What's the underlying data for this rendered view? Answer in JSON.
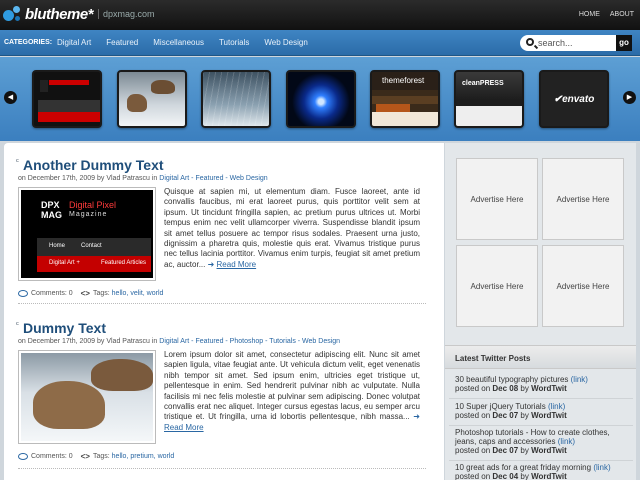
{
  "brand": {
    "logo": "blutheme*",
    "domain": "dpxmag.com"
  },
  "top_nav": [
    "HOME",
    "ABOUT"
  ],
  "categories": {
    "label": "CATEGORIES:",
    "items": [
      "Digital Art",
      "Featured",
      "Miscellaneous",
      "Tutorials",
      "Web Design"
    ]
  },
  "search": {
    "placeholder": "search...",
    "button": "go"
  },
  "carousel": {
    "prev": "◀",
    "next": "▶",
    "thumbs": [
      "DPX Digital Pixel Magazine",
      "Cougars in snow",
      "Snow storm",
      "Blue orb",
      "themeforest",
      "cleanpress",
      "envato"
    ],
    "labels": {
      "themeforest": "themeforest",
      "cleanpress": "cleanPRESS",
      "envato": "✔envato"
    }
  },
  "posts": [
    {
      "title": "Another Dummy Text",
      "meta": {
        "prefix": "on December 17th, 2009 by Vlad Patrascu in",
        "cats": "Digital Art - Featured - Web Design"
      },
      "image": {
        "dpx": "DPX",
        "mag": "MAG",
        "title": "Digital Pixel",
        "subtitle": "Magazine",
        "nav1": "Home",
        "nav2": "Contact",
        "red1": "Digital Art +",
        "red2": "Featured Articles"
      },
      "excerpt": "Quisque at sapien mi, ut elementum diam. Fusce laoreet, ante id convallis faucibus, mi erat laoreet purus, quis porttitor velit sem at ipsum. Ut tincidunt fringilla sapien, ac pretium purus ultrices ut. Morbi tempus enim nec velit ullamcorper viverra. Suspendisse blandit ipsum sit amet tellus posuere ac tempor risus sodales. Praesent urna justo, dignissim a pharetra quis, molestie quis erat. Vivamus tristique purus nec tellus lacinia porttitor. Vivamus enim turpis, feugiat sit amet pretium ac, auctor...",
      "read_more": "Read More",
      "comments": "Comments: 0",
      "tags_prefix": "Tags:",
      "tags": "hello, velit, world"
    },
    {
      "title": "Dummy Text",
      "meta": {
        "prefix": "on December 17th, 2009 by Vlad Patrascu in",
        "cats": "Digital Art - Featured - Photoshop - Tutorials - Web Design"
      },
      "excerpt": "Lorem ipsum dolor sit amet, consectetur adipiscing elit. Nunc sit amet sapien ligula, vitae feugiat ante. Ut vehicula dictum velit, eget venenatis nibh tempor sit amet. Sed ipsum enim, ultricies eget tristique ut, pellentesque in enim. Sed hendrerit pulvinar nibh ac vulputate. Nulla facilisis mi nec felis molestie at pulvinar sem adipiscing. Donec volutpat convallis erat nec aliquet. Integer cursus egestas lacus, eu semper arcu tristique et. Ut fringilla, urna id lobortis pellentesque, nibh massa...",
      "read_more": "Read More",
      "comments": "Comments: 0",
      "tags_prefix": "Tags:",
      "tags": "hello, pretium, world"
    }
  ],
  "sidebar": {
    "ads": [
      "Advertise Here",
      "Advertise Here",
      "Advertise Here",
      "Advertise Here"
    ],
    "twitter_title": "Latest Twitter Posts",
    "tweets": [
      {
        "text": "30 beautiful typography pictures",
        "link": "(link)",
        "posted": "posted on",
        "date": "Dec 08",
        "by": "by",
        "user": "WordTwit"
      },
      {
        "text": "10 Super jQuery Tutorials",
        "link": "(link)",
        "posted": "posted on",
        "date": "Dec 07",
        "by": "by",
        "user": "WordTwit"
      },
      {
        "text": "Photoshop tutorials - How to create clothes, jeans, caps and accessories",
        "link": "(link)",
        "posted": "posted on",
        "date": "Dec 07",
        "by": "by",
        "user": "WordTwit"
      },
      {
        "text": "10 great ads for a great friday morning",
        "link": "(link)",
        "posted": "posted on",
        "date": "Dec 04",
        "by": "by",
        "user": "WordTwit"
      }
    ]
  }
}
